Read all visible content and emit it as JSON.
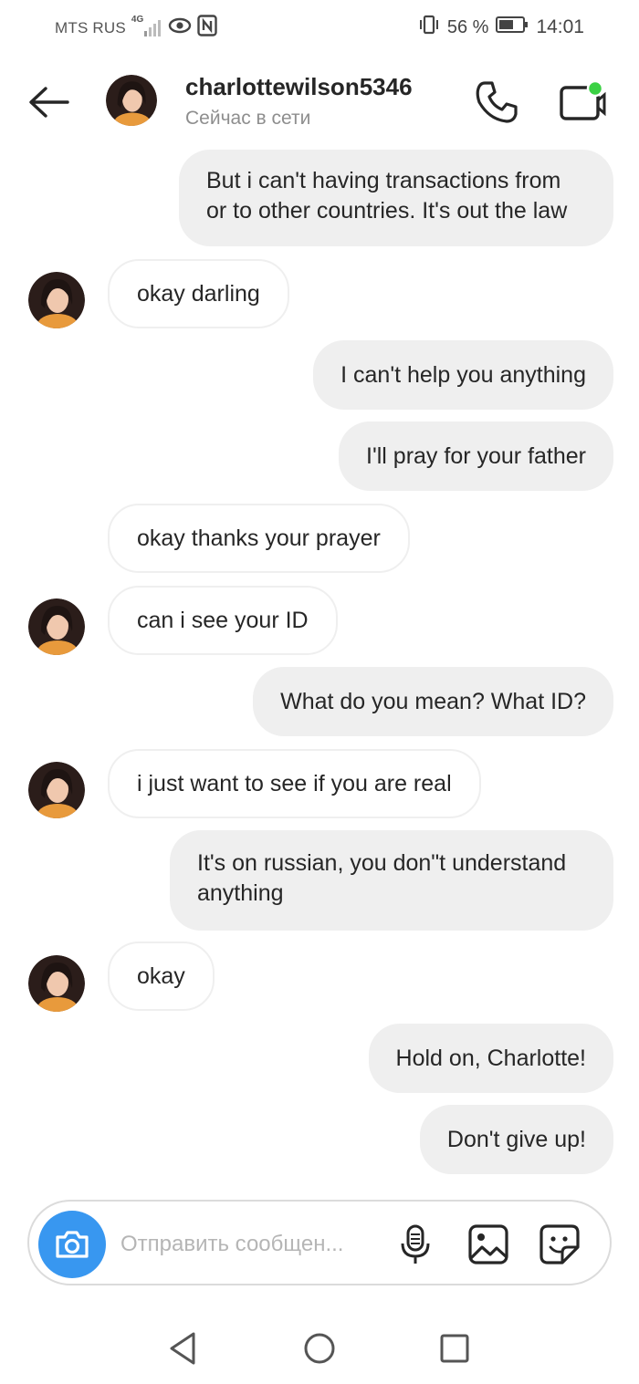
{
  "status_bar": {
    "carrier": "MTS RUS",
    "network": "4G",
    "battery": "56 %",
    "time": "14:01"
  },
  "header": {
    "username": "charlottewilson5346",
    "status": "Сейчас в сети",
    "online_dot_color": "#3bd144"
  },
  "messages": [
    {
      "side": "sent",
      "lines": [
        "But i can't having transactions from",
        "or to other countries. It's out the law"
      ]
    },
    {
      "side": "recv",
      "avatar": true,
      "text": "okay darling"
    },
    {
      "side": "sent",
      "text": "I can't help you anything"
    },
    {
      "side": "sent",
      "text": "I'll pray for your father"
    },
    {
      "side": "recv",
      "avatar": false,
      "text": "okay thanks your prayer"
    },
    {
      "side": "recv",
      "avatar": true,
      "text": "can i see your ID"
    },
    {
      "side": "sent",
      "text": "What do you mean? What ID?"
    },
    {
      "side": "recv",
      "avatar": true,
      "text": "i just want to see if you are real"
    },
    {
      "side": "sent",
      "lines": [
        "It's on russian, you don\"t understand",
        "anything"
      ]
    },
    {
      "side": "recv",
      "avatar": true,
      "text": "okay"
    },
    {
      "side": "sent",
      "text": "Hold on, Charlotte!"
    },
    {
      "side": "sent",
      "text": "Don't give up!"
    }
  ],
  "composer": {
    "placeholder": "Отправить сообщен...",
    "camera_color": "#3897f0"
  },
  "icons": [
    "back-arrow-icon",
    "phone-icon",
    "video-camera-icon",
    "camera-icon",
    "microphone-icon",
    "gallery-icon",
    "sticker-icon",
    "nav-back-icon",
    "nav-home-icon",
    "nav-recents-icon"
  ]
}
